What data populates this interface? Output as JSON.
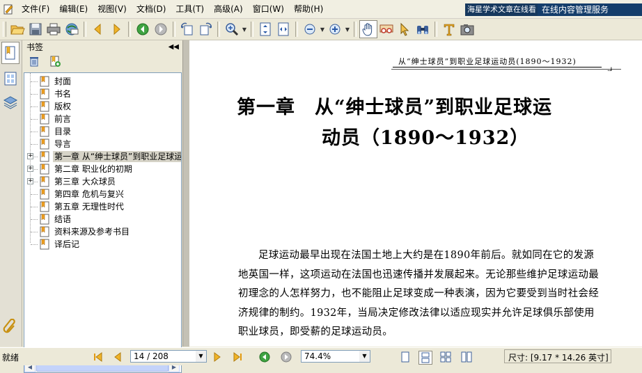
{
  "menu": [
    "文件(F)",
    "编辑(E)",
    "视图(V)",
    "文档(D)",
    "工具(T)",
    "高级(A)",
    "窗口(W)",
    "帮助(H)"
  ],
  "ad": {
    "left_text": "海星学术文章在线看",
    "right_text": "在线内容管理服务"
  },
  "toolbar_icons": [
    "open-folder-icon",
    "save-icon",
    "print-icon",
    "email-icon",
    "prev-arrow-icon",
    "next-arrow-icon",
    "back-icon",
    "forward-icon",
    "rotate-ccw-icon",
    "rotate-cw-icon",
    "zoom-in-icon",
    "fit-page-icon",
    "fit-width-icon",
    "zoom-out-minus-icon",
    "zoom-in-plus-icon",
    "hand-icon",
    "glasses-icon",
    "select-cursor-icon",
    "binoculars-icon",
    "text-tool-icon",
    "snapshot-icon"
  ],
  "bookmarks": {
    "header": "书签",
    "items": [
      {
        "label": "封面",
        "expandable": false
      },
      {
        "label": "书名",
        "expandable": false
      },
      {
        "label": "版权",
        "expandable": false
      },
      {
        "label": "前言",
        "expandable": false
      },
      {
        "label": "目录",
        "expandable": false
      },
      {
        "label": "导言",
        "expandable": false
      },
      {
        "label": "第一章  从“绅士球员”到职业足球运",
        "expandable": true,
        "selected": true
      },
      {
        "label": "第二章  职业化的初期",
        "expandable": true
      },
      {
        "label": "第三章  大众球员",
        "expandable": true
      },
      {
        "label": "第四章  危机与复兴",
        "expandable": false
      },
      {
        "label": "第五章  无理性时代",
        "expandable": false
      },
      {
        "label": "结语",
        "expandable": false
      },
      {
        "label": "资料来源及参考书目",
        "expandable": false
      },
      {
        "label": "译后记",
        "expandable": false
      }
    ]
  },
  "document": {
    "running_head": "从“绅士球员”到职业足球运动员(1890～1932)",
    "chapter_line1": "第一章　从“绅士球员”到职业足球运",
    "chapter_line2": "动员（1890～1932）",
    "body": "足球运动最早出现在法国土地上大约是在1890年前后。就如同在它的发源地英国一样，这项运动在法国也迅速传播并发展起来。无论那些维护足球运动最初理念的人怎样努力，也不能阻止足球变成一种表演，因为它要受到当时社会经济规律的制约。1932年，当局决定修改法律以适应现实并允许足球俱乐部使用职业球员，即受薪的足球运动员。"
  },
  "status": {
    "text": "就绪",
    "page_display": "14 / 208",
    "zoom": "74.4%",
    "size": "尺寸: [9.17 * 14.26 英寸]"
  }
}
